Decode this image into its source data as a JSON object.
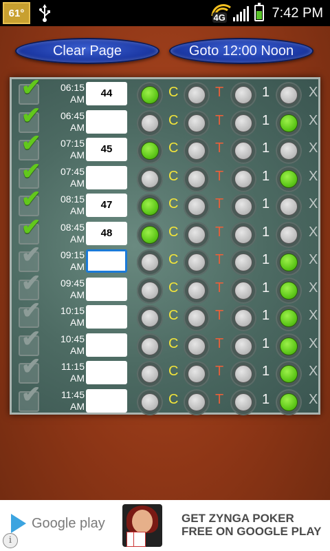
{
  "status_bar": {
    "temperature": "61°",
    "network": "4G",
    "time": "7:42 PM",
    "icons": [
      "usb-icon",
      "network-4g-icon",
      "signal-icon",
      "battery-charging-icon"
    ]
  },
  "buttons": {
    "clear_page": "Clear Page",
    "goto_noon": "Goto 12:00 Noon"
  },
  "option_labels": {
    "c": "C",
    "t": "T",
    "one": "1",
    "x": "X"
  },
  "schedule": [
    {
      "time": "06:15",
      "period": "AM",
      "checked": true,
      "value": "44",
      "selected": "C"
    },
    {
      "time": "06:45",
      "period": "AM",
      "checked": true,
      "value": "",
      "selected": "X"
    },
    {
      "time": "07:15",
      "period": "AM",
      "checked": true,
      "value": "45",
      "selected": "C"
    },
    {
      "time": "07:45",
      "period": "AM",
      "checked": true,
      "value": "",
      "selected": "X"
    },
    {
      "time": "08:15",
      "period": "AM",
      "checked": true,
      "value": "47",
      "selected": "C"
    },
    {
      "time": "08:45",
      "period": "AM",
      "checked": true,
      "value": "48",
      "selected": "C"
    },
    {
      "time": "09:15",
      "period": "AM",
      "checked": false,
      "value": "",
      "selected": "X",
      "focused": true
    },
    {
      "time": "09:45",
      "period": "AM",
      "checked": false,
      "value": "",
      "selected": "X"
    },
    {
      "time": "10:15",
      "period": "AM",
      "checked": false,
      "value": "",
      "selected": "X"
    },
    {
      "time": "10:45",
      "period": "AM",
      "checked": false,
      "value": "",
      "selected": "X"
    },
    {
      "time": "11:15",
      "period": "AM",
      "checked": false,
      "value": "",
      "selected": "X"
    },
    {
      "time": "11:45",
      "period": "AM",
      "checked": false,
      "value": "",
      "selected": "X"
    }
  ],
  "ad": {
    "store_label": "Google play",
    "headline_1": "GET ZYNGA POKER",
    "headline_2": "FREE ON GOOGLE PLAY",
    "info_symbol": "i"
  },
  "colors": {
    "check_on": "#62c81c",
    "radio_on": "#5fc81a",
    "button_blue": "#1d3aa6",
    "wood": "#8e3616",
    "panel": "#4d6b63"
  }
}
